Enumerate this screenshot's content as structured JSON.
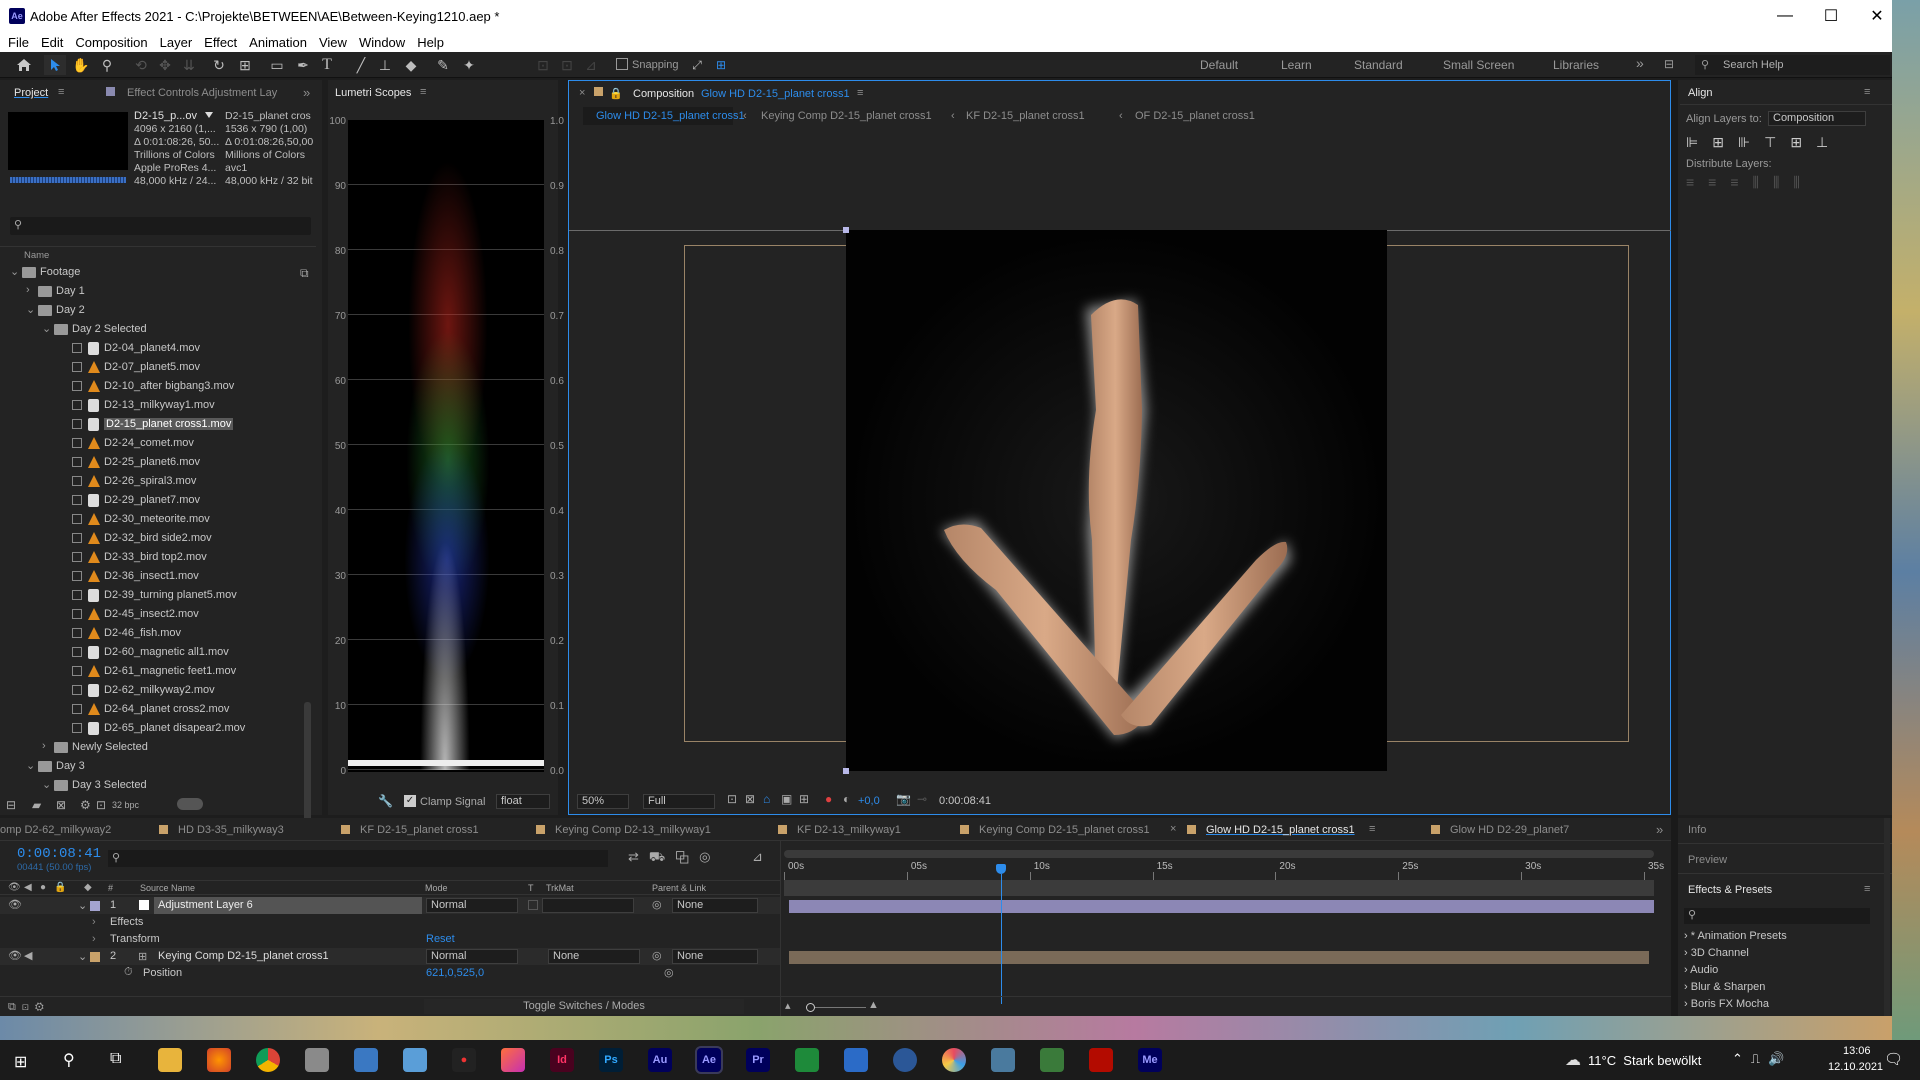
{
  "window": {
    "title": "Adobe After Effects 2021 - C:\\Projekte\\BETWEEN\\AE\\Between-Keying1210.aep *",
    "app_badge": "Ae",
    "buttons": {
      "minimize": "—",
      "maximize": "☐",
      "close": "✕"
    }
  },
  "menu": [
    "File",
    "Edit",
    "Composition",
    "Layer",
    "Effect",
    "Animation",
    "View",
    "Window",
    "Help"
  ],
  "toolbar": {
    "snapping": "Snapping",
    "workspaces": [
      "Default",
      "Learn",
      "Standard",
      "Small Screen",
      "Libraries"
    ],
    "search_help": "Search Help"
  },
  "project": {
    "tabs": [
      "Project",
      "Effect Controls Adjustment Lay"
    ],
    "info": {
      "name": "D2-15_p...ov",
      "col1": [
        "4096 x 2160 (1,...",
        "Δ 0:01:08:26, 50...",
        "Trillions of Colors",
        "Apple ProRes 4...",
        "48,000 kHz / 24..."
      ],
      "col2_title": "D2-15_planet cros",
      "col2": [
        "1536 x 790 (1,00)",
        "Δ 0:01:08:26,50,00",
        "Millions of Colors",
        "avc1",
        "48,000 kHz / 32 bit"
      ]
    },
    "column_name": "Name",
    "tree": [
      {
        "label": "Footage",
        "type": "folder",
        "indent": 0,
        "open": true
      },
      {
        "label": "Day 1",
        "type": "folder",
        "indent": 1,
        "open": false
      },
      {
        "label": "Day 2",
        "type": "folder",
        "indent": 1,
        "open": true
      },
      {
        "label": "Day 2 Selected",
        "type": "folder",
        "indent": 2,
        "open": true
      },
      {
        "label": "D2-04_planet4.mov",
        "type": "qt",
        "indent": 3
      },
      {
        "label": "D2-07_planet5.mov",
        "type": "vlc",
        "indent": 3
      },
      {
        "label": "D2-10_after bigbang3.mov",
        "type": "vlc",
        "indent": 3
      },
      {
        "label": "D2-13_milkyway1.mov",
        "type": "qt",
        "indent": 3
      },
      {
        "label": "D2-15_planet cross1.mov",
        "type": "qt",
        "indent": 3,
        "selected": true
      },
      {
        "label": "D2-24_comet.mov",
        "type": "vlc",
        "indent": 3
      },
      {
        "label": "D2-25_planet6.mov",
        "type": "vlc",
        "indent": 3
      },
      {
        "label": "D2-26_spiral3.mov",
        "type": "vlc",
        "indent": 3
      },
      {
        "label": "D2-29_planet7.mov",
        "type": "qt",
        "indent": 3
      },
      {
        "label": "D2-30_meteorite.mov",
        "type": "vlc",
        "indent": 3
      },
      {
        "label": "D2-32_bird side2.mov",
        "type": "vlc",
        "indent": 3
      },
      {
        "label": "D2-33_bird top2.mov",
        "type": "vlc",
        "indent": 3
      },
      {
        "label": "D2-36_insect1.mov",
        "type": "vlc",
        "indent": 3
      },
      {
        "label": "D2-39_turning planet5.mov",
        "type": "qt",
        "indent": 3
      },
      {
        "label": "D2-45_insect2.mov",
        "type": "vlc",
        "indent": 3
      },
      {
        "label": "D2-46_fish.mov",
        "type": "vlc",
        "indent": 3
      },
      {
        "label": "D2-60_magnetic all1.mov",
        "type": "qt",
        "indent": 3
      },
      {
        "label": "D2-61_magnetic feet1.mov",
        "type": "vlc",
        "indent": 3
      },
      {
        "label": "D2-62_milkyway2.mov",
        "type": "qt",
        "indent": 3
      },
      {
        "label": "D2-64_planet cross2.mov",
        "type": "vlc",
        "indent": 3
      },
      {
        "label": "D2-65_planet disapear2.mov",
        "type": "qt",
        "indent": 3
      },
      {
        "label": "Newly Selected",
        "type": "folder",
        "indent": 2,
        "open": false
      },
      {
        "label": "Day 3",
        "type": "folder",
        "indent": 1,
        "open": true
      },
      {
        "label": "Day 3 Selected",
        "type": "folder",
        "indent": 2,
        "open": true
      }
    ],
    "bpc": "32 bpc"
  },
  "scopes": {
    "tab": "Lumetri Scopes",
    "left_scale": [
      "100",
      "90",
      "80",
      "70",
      "60",
      "50",
      "40",
      "30",
      "20",
      "10",
      "0"
    ],
    "right_scale": [
      "1.0",
      "0.9",
      "0.8",
      "0.7",
      "0.6",
      "0.5",
      "0.4",
      "0.3",
      "0.2",
      "0.1",
      "0.0"
    ],
    "clamp_signal": "Clamp Signal",
    "mode": "float"
  },
  "composition": {
    "label": "Composition",
    "name": "Glow HD D2-15_planet cross1",
    "breadcrumbs": [
      "Glow HD D2-15_planet cross1",
      "Keying Comp D2-15_planet cross1",
      "KF D2-15_planet cross1",
      "OF D2-15_planet cross1"
    ],
    "zoom": "50%",
    "resolution": "Full",
    "exposure": "+0,0",
    "timecode": "0:00:08:41"
  },
  "align": {
    "title": "Align",
    "align_layers_to_label": "Align Layers to:",
    "align_layers_to": "Composition",
    "distribute_label": "Distribute Layers:"
  },
  "side_panels": [
    "Info",
    "Preview",
    "Effects & Presets"
  ],
  "effects_list": [
    "* Animation Presets",
    "3D Channel",
    "Audio",
    "Blur & Sharpen",
    "Boris FX Mocha"
  ],
  "timeline": {
    "tabs": [
      "omp D2-62_milkyway2",
      "HD D3-35_milkyway3",
      "KF D2-15_planet cross1",
      "Keying Comp D2-13_milkyway1",
      "KF D2-13_milkyway1",
      "Keying Comp D2-15_planet cross1",
      "Glow HD D2-15_planet cross1",
      "Glow HD D2-29_planet7"
    ],
    "active_tab": 6,
    "timecode": "0:00:08:41",
    "frame_info": "00441 (50.00 fps)",
    "columns": {
      "source_name": "Source Name",
      "mode": "Mode",
      "t": "T",
      "trkmat": "TrkMat",
      "parent": "Parent & Link"
    },
    "ruler": [
      "00s",
      "05s",
      "10s",
      "15s",
      "20s",
      "25s",
      "30s",
      "35s"
    ],
    "current_time_seconds": 8.82,
    "duration_seconds": 35,
    "layers": [
      {
        "num": "1",
        "name": "Adjustment Layer 6",
        "mode": "Normal",
        "trkmat": "",
        "parent": "None"
      },
      {
        "num": "2",
        "name": "Keying Comp D2-15_planet cross1",
        "mode": "Normal",
        "trkmat": "None",
        "parent": "None"
      }
    ],
    "sub_rows": {
      "effects": "Effects",
      "transform": "Transform",
      "reset": "Reset",
      "position": "Position",
      "position_value": "621,0,525,0"
    },
    "toggle": "Toggle Switches / Modes"
  },
  "taskbar": {
    "weather": "11°C  Stark bewölkt",
    "time": "13:06",
    "date": "12.10.2021",
    "apps": [
      "Id",
      "Ps",
      "Au",
      "Ae",
      "Pr",
      "Me"
    ]
  },
  "colors": {
    "accent_blue": "#2d8ceb",
    "ae_purple": "#9999ff",
    "selection": "#5a5a5a"
  }
}
